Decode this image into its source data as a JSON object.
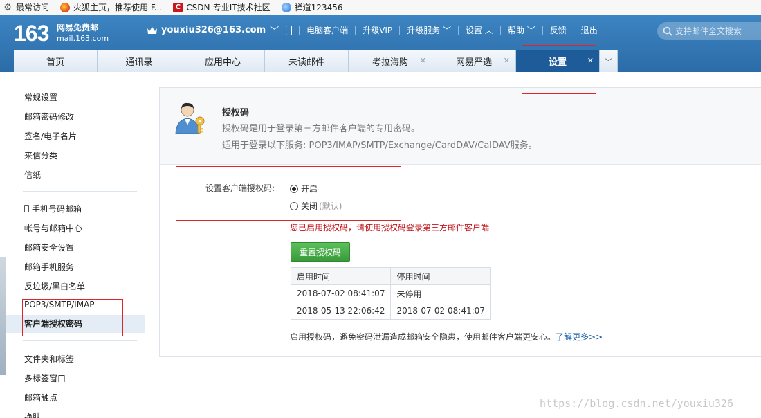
{
  "bookmarks": [
    {
      "label": "最常访问",
      "icon": "gear-icon"
    },
    {
      "label": "火狐主页，推荐使用 F...",
      "icon": "firefox-icon"
    },
    {
      "label": "CSDN-专业IT技术社区",
      "icon": "csdn-icon"
    },
    {
      "label": "禅道123456",
      "icon": "globe-icon"
    }
  ],
  "header": {
    "logo_number": "163",
    "logo_line1": "网易免费邮",
    "logo_line2": "mail.163.com",
    "account": "youxiu326@163.com",
    "nav": [
      "电脑客户端",
      "升级VIP",
      "升级服务",
      "设置",
      "帮助",
      "反馈",
      "退出"
    ],
    "search_placeholder": "支持邮件全文搜索"
  },
  "tabs": [
    {
      "label": "首页",
      "closable": false,
      "active": false
    },
    {
      "label": "通讯录",
      "closable": false,
      "active": false
    },
    {
      "label": "应用中心",
      "closable": false,
      "active": false
    },
    {
      "label": "未读邮件",
      "closable": false,
      "active": false
    },
    {
      "label": "考拉海购",
      "closable": true,
      "active": false
    },
    {
      "label": "网易严选",
      "closable": true,
      "active": false
    },
    {
      "label": "设置",
      "closable": true,
      "active": true
    }
  ],
  "sidebar": {
    "items": [
      {
        "label": "常规设置"
      },
      {
        "label": "邮箱密码修改"
      },
      {
        "label": "签名/电子名片"
      },
      {
        "label": "来信分类"
      },
      {
        "label": "信纸"
      },
      {
        "label": "手机号码邮箱"
      },
      {
        "label": "帐号与邮箱中心"
      },
      {
        "label": "邮箱安全设置"
      },
      {
        "label": "邮箱手机服务"
      },
      {
        "label": "反垃圾/黑白名单"
      },
      {
        "label": "POP3/SMTP/IMAP"
      },
      {
        "label": "客户端授权密码"
      },
      {
        "label": "文件夹和标签"
      },
      {
        "label": "多标签窗口"
      },
      {
        "label": "邮箱触点"
      },
      {
        "label": "换肤"
      }
    ],
    "active_item": "客户端授权密码"
  },
  "auth": {
    "title": "授权码",
    "description": "授权码是用于登录第三方邮件客户端的专用密码。",
    "services": "适用于登录以下服务: POP3/IMAP/SMTP/Exchange/CardDAV/CalDAV服务。",
    "setting_label": "设置客户端授权码:",
    "option_on": "开启",
    "option_off": "关闭",
    "option_off_note": "(默认)",
    "selected": "开启",
    "notice": "您已启用授权码，请使用授权码登录第三方邮件客户端",
    "reset_button": "重置授权码",
    "table_headers": [
      "启用时间",
      "停用时间"
    ],
    "table_rows": [
      [
        "2018-07-02 08:41:07",
        "未停用"
      ],
      [
        "2018-05-13 22:06:42",
        "2018-07-02 08:41:07"
      ]
    ],
    "footer_text": "启用授权码，避免密码泄漏造成邮箱安全隐患，使用邮件客户端更安心。",
    "footer_link": "了解更多>>"
  },
  "watermark": "https://blog.csdn.net/youxiu326",
  "colors": {
    "header_blue": "#2b6ca7",
    "active_tab": "#1d5c98",
    "notice_red": "#c0141b",
    "button_green": "#3a9a3a",
    "annotation_red": "#e0242b"
  }
}
